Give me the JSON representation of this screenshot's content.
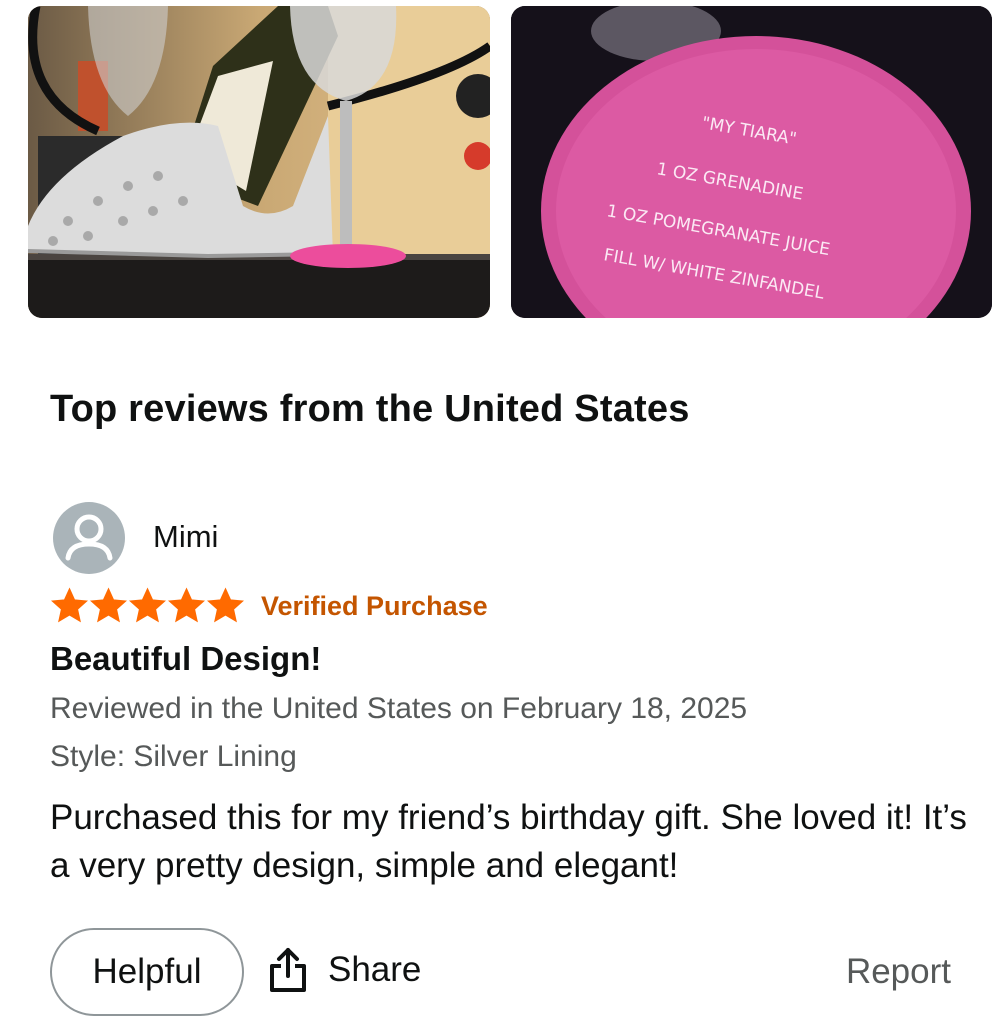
{
  "images": [
    {
      "name": "shoe-wine-holder-photo"
    },
    {
      "name": "tiara-glass-base-photo",
      "recipe_lines": [
        "\"MY TIARA\"",
        "1 OZ GRENADINE",
        "1 OZ POMEGRANATE JUICE",
        "FILL W/ WHITE ZINFANDEL"
      ]
    }
  ],
  "reviews_section": {
    "title": "Top reviews from the United States"
  },
  "review": {
    "reviewer": {
      "name": "Mimi",
      "avatar_icon": "person-icon"
    },
    "rating": 5,
    "rating_max": 5,
    "star_color": "#ff6a00",
    "verified_label": "Verified Purchase",
    "verified_color": "#c45500",
    "title": "Beautiful Design!",
    "date_line": "Reviewed in the United States on February 18, 2025",
    "style_line": "Style: Silver Lining",
    "body": "Purchased this for my friend’s birthday gift. She loved it! It’s a very pretty design, simple and elegant!"
  },
  "actions": {
    "helpful_label": "Helpful",
    "share_label": "Share",
    "share_icon": "share-icon",
    "report_label": "Report"
  }
}
